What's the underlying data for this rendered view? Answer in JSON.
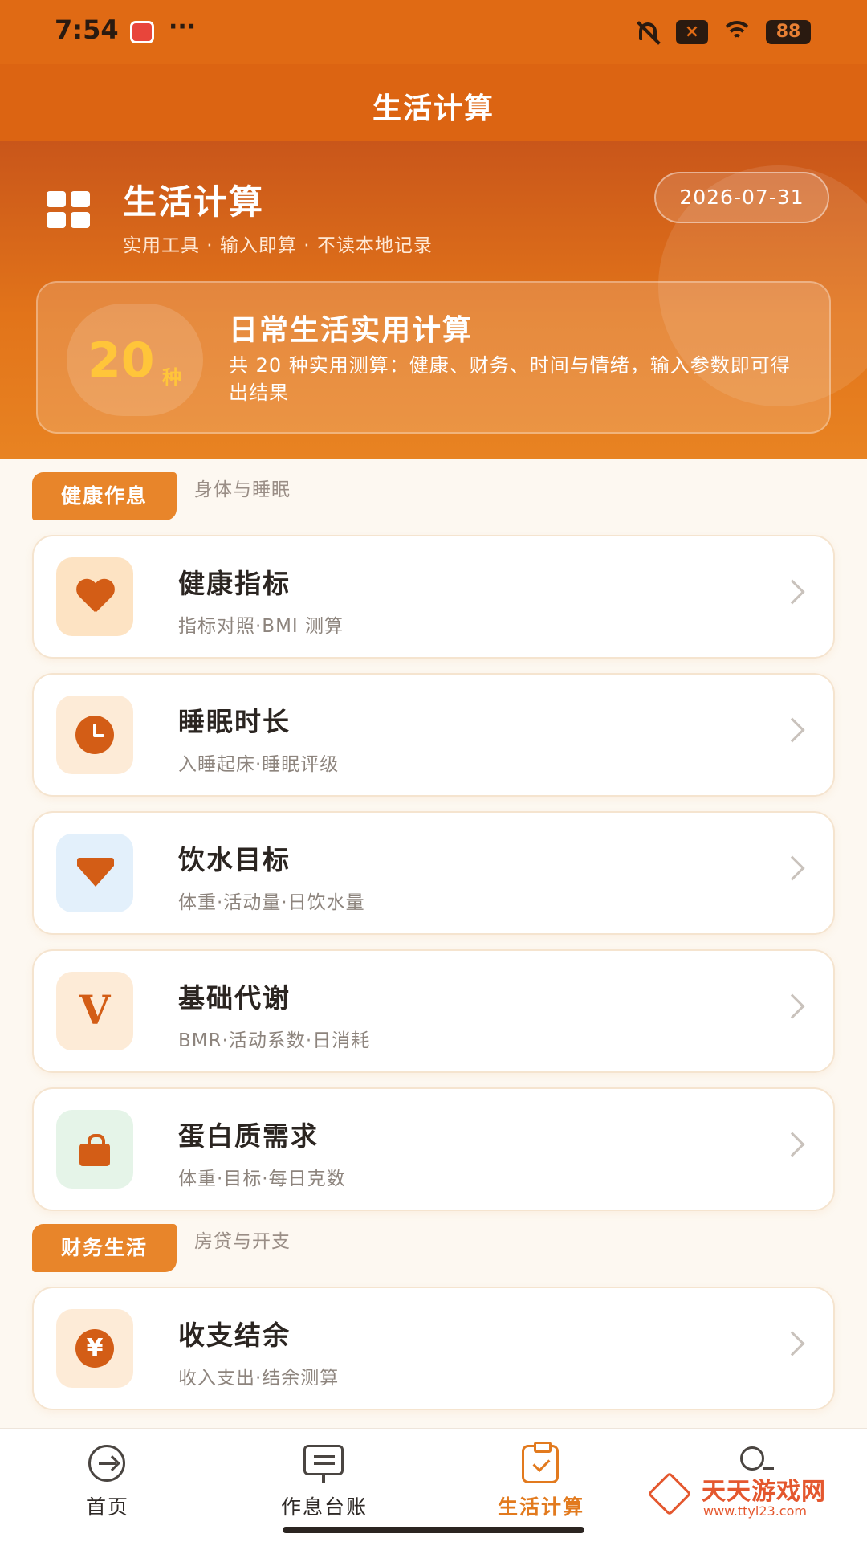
{
  "status_bar": {
    "time": "7:54",
    "dots": "···",
    "sim": "×",
    "battery": "88"
  },
  "header": {
    "title": "生活计算"
  },
  "hero": {
    "title": "生活计算",
    "subtitle": "实用工具 · 输入即算 · 不读本地记录",
    "date": "2026-07-31",
    "summary": {
      "count": "20",
      "count_unit": "种",
      "title": "日常生活实用计算",
      "description": "共 20 种实用测算：健康、财务、时间与情绪，输入参数即可得出结果"
    }
  },
  "sections": [
    {
      "tag": "健康作息",
      "subtitle": "身体与睡眠",
      "items": [
        {
          "title": "健康指标",
          "subtitle": "指标对照·BMI 测算",
          "icon": "heart-icon",
          "icon_bg": "#fde3c3"
        },
        {
          "title": "睡眠时长",
          "subtitle": "入睡起床·睡眠评级",
          "icon": "clock-icon",
          "icon_bg": "#fdebd7"
        },
        {
          "title": "饮水目标",
          "subtitle": "体重·活动量·日饮水量",
          "icon": "gem-icon",
          "icon_bg": "#e3f0fb"
        },
        {
          "title": "基础代谢",
          "subtitle": "BMR·活动系数·日消耗",
          "icon": "v-icon",
          "icon_glyph": "V",
          "icon_bg": "#fdebd7"
        },
        {
          "title": "蛋白质需求",
          "subtitle": "体重·目标·每日克数",
          "icon": "bag-icon",
          "icon_bg": "#e5f4e8"
        }
      ]
    },
    {
      "tag": "财务生活",
      "subtitle": "房贷与开支",
      "items": [
        {
          "title": "收支结余",
          "subtitle": "收入支出·结余测算",
          "icon": "yen-icon",
          "icon_glyph": "¥",
          "icon_bg": "#fdebd7"
        }
      ]
    }
  ],
  "bottom_nav": [
    {
      "label": "首页",
      "icon": "arrow-circle-icon",
      "active": false
    },
    {
      "label": "作息台账",
      "icon": "monitor-icon",
      "active": false
    },
    {
      "label": "生活计算",
      "icon": "clipboard-check-icon",
      "active": true
    },
    {
      "label": "",
      "icon": "person-icon",
      "active": false
    }
  ],
  "watermark": {
    "text": "天天游戏网",
    "url": "www.ttyl23.com"
  },
  "colors": {
    "primary": "#e06a14",
    "accent": "#e8852a",
    "icon": "#d35d16",
    "count": "#ffc53a"
  }
}
